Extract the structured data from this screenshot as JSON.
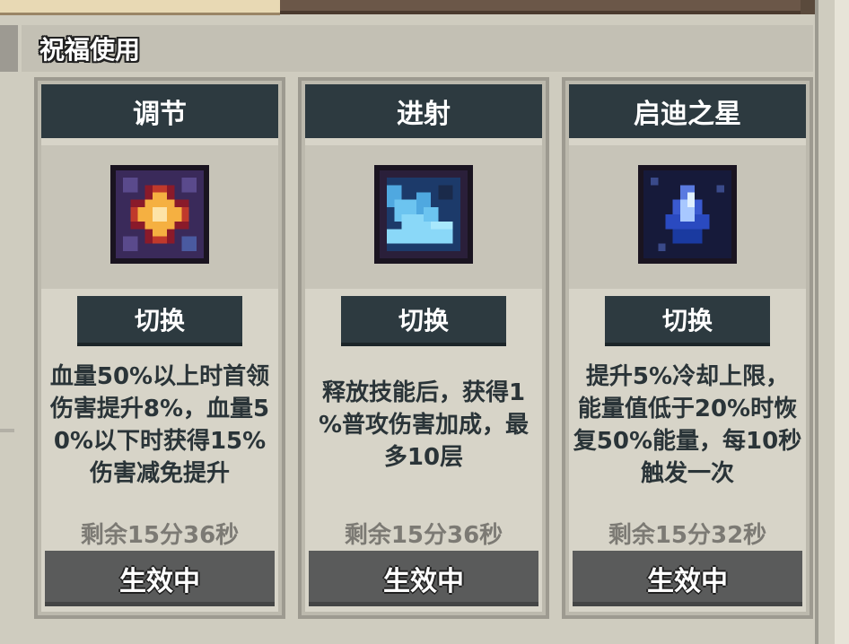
{
  "section": {
    "title": "祝福使用"
  },
  "cards": [
    {
      "title": "调节",
      "icon": "star-burst-icon",
      "switch_label": "切换",
      "description": [
        "血量50%以上时首领",
        "伤害提升8%，血量5",
        "0%以下时获得15%",
        "伤害减免提升"
      ],
      "remaining": "剩余15分36秒",
      "status": "生效中"
    },
    {
      "title": "进射",
      "icon": "ice-shard-icon",
      "switch_label": "切换",
      "description": [
        "释放技能后，获得1",
        "%普攻伤害加成，最",
        "多10层"
      ],
      "remaining": "剩余15分36秒",
      "status": "生效中"
    },
    {
      "title": "启迪之星",
      "icon": "blue-crystal-icon",
      "switch_label": "切换",
      "description": [
        "提升5%冷却上限，",
        "能量值低于20%时恢",
        "复50%能量，每10秒",
        "触发一次"
      ],
      "remaining": "剩余15分32秒",
      "status": "生效中"
    }
  ]
}
